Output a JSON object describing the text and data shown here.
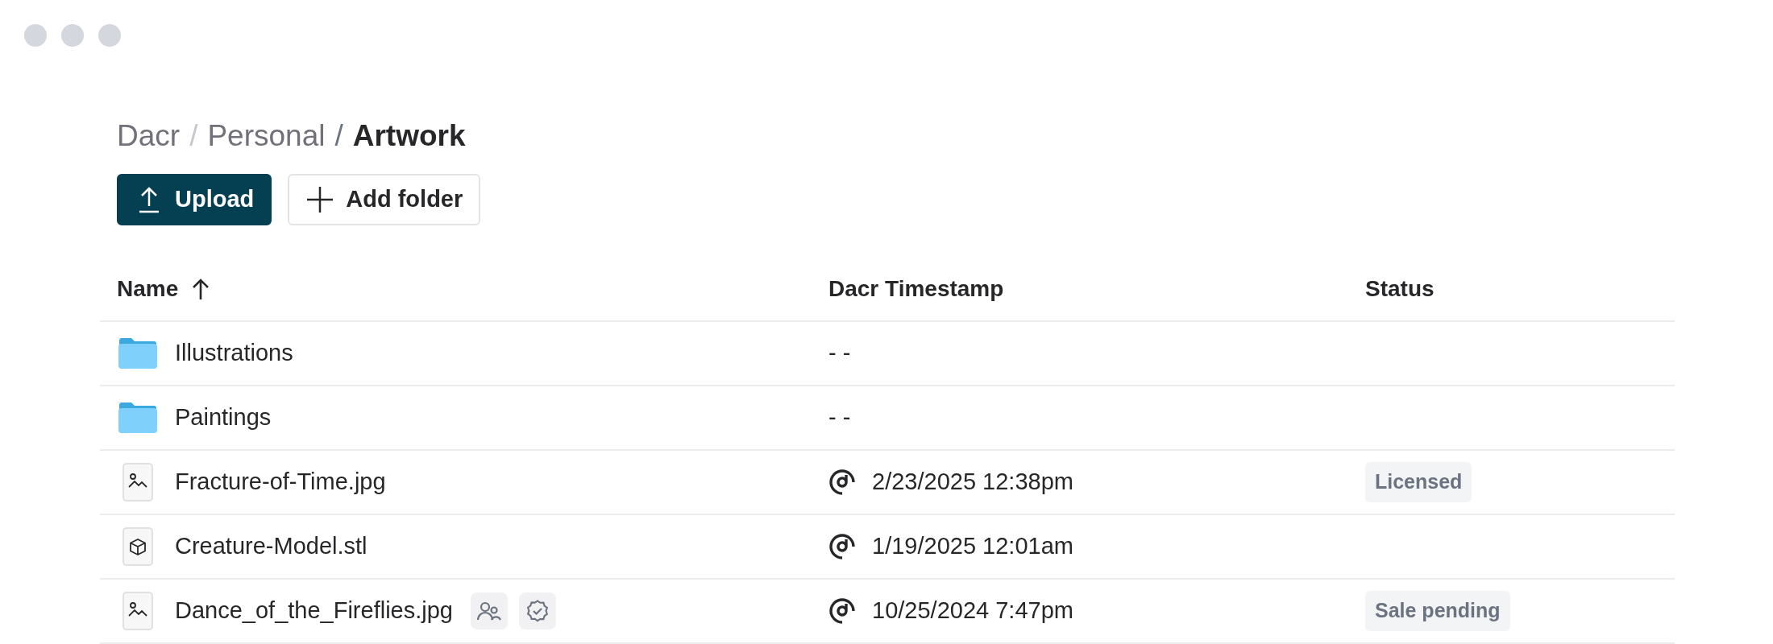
{
  "breadcrumb_separator": "/",
  "breadcrumb": [
    {
      "label": "Dacr",
      "current": false
    },
    {
      "label": "Personal",
      "current": false
    },
    {
      "label": "Artwork",
      "current": true
    }
  ],
  "buttons": [
    {
      "label": "Upload",
      "kind": "primary"
    },
    {
      "label": "Add folder",
      "kind": "secondary"
    }
  ],
  "table": {
    "columns": [
      {
        "label": "Name",
        "sorted_ascending": true
      },
      {
        "label": "Dacr Timestamp"
      },
      {
        "label": "Status"
      }
    ],
    "rows": [
      {
        "kind": "folder",
        "name": "Illustrations",
        "timestamp": "- -"
      },
      {
        "kind": "folder",
        "name": "Paintings",
        "timestamp": "- -"
      },
      {
        "kind": "image",
        "name": "Fracture-of-Time.jpg",
        "timestamp": "2/23/2025 12:38pm",
        "stamped": true,
        "status": "Licensed"
      },
      {
        "kind": "model",
        "name": "Creature-Model.stl",
        "timestamp": "1/19/2025 12:01am",
        "stamped": true
      },
      {
        "kind": "image",
        "name": "Dance_of_the_Fireflies.jpg",
        "badges": [
          {
            "kind": "shared"
          },
          {
            "kind": "verified"
          }
        ],
        "timestamp": "10/25/2024 7:47pm",
        "stamped": true,
        "status": "Sale pending"
      }
    ]
  }
}
